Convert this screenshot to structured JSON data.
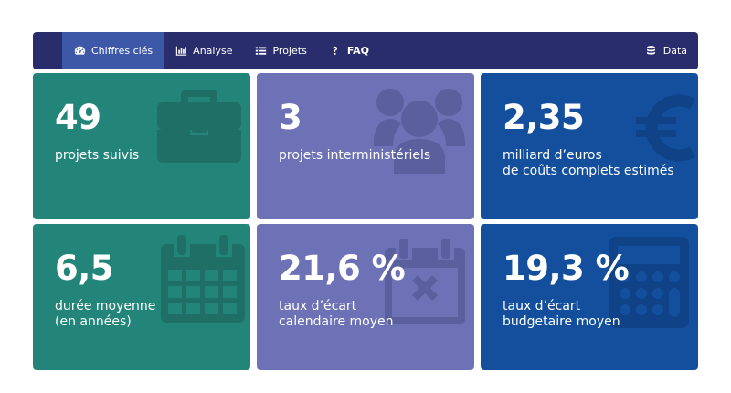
{
  "nav": {
    "items": [
      {
        "label": "Chiffres clés",
        "icon": "dashboard-gauge-icon",
        "active": true
      },
      {
        "label": "Analyse",
        "icon": "bar-chart-icon",
        "active": false
      },
      {
        "label": "Projets",
        "icon": "list-icon",
        "active": false
      },
      {
        "label": "FAQ",
        "icon": "question-mark-icon",
        "active": false
      }
    ],
    "right": {
      "label": "Data",
      "icon": "database-icon"
    }
  },
  "cards": [
    {
      "value": "49",
      "line1": "projets suivis",
      "line2": "",
      "icon": "briefcase-icon",
      "color": "#23857a"
    },
    {
      "value": "3",
      "line1": "projets interministériels",
      "line2": "",
      "icon": "users-group-icon",
      "color": "#6c72b5"
    },
    {
      "value": "2,35",
      "line1": "milliard d’euros",
      "line2": "de coûts complets estimés",
      "icon": "euro-icon",
      "color": "#134f9d"
    },
    {
      "value": "6,5",
      "line1": "durée moyenne",
      "line2": "(en années)",
      "icon": "calendar-icon",
      "color": "#23857a"
    },
    {
      "value": "21,6 %",
      "line1": "taux d’écart",
      "line2": "calendaire moyen",
      "icon": "calendar-x-icon",
      "color": "#6c72b5"
    },
    {
      "value": "19,3 %",
      "line1": "taux d’écart",
      "line2": "budgetaire moyen",
      "icon": "calculator-icon",
      "color": "#134f9d"
    }
  ]
}
